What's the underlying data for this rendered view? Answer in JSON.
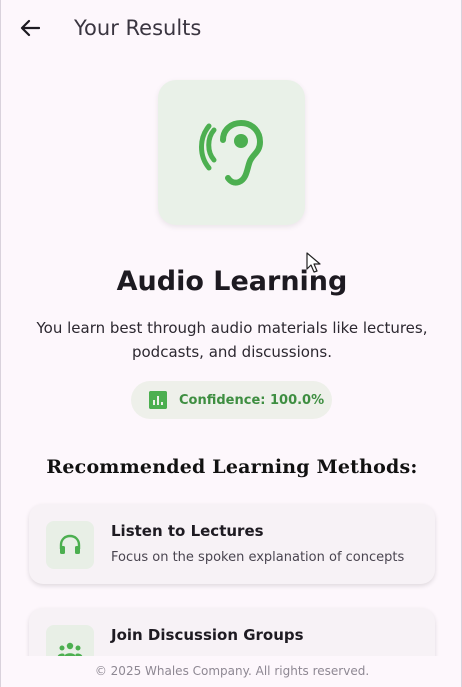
{
  "appbar": {
    "title": "Your Results",
    "back_icon": "arrow-left-icon"
  },
  "result": {
    "icon": "ear-hearing-icon",
    "style_title": "Audio Learning",
    "description": "You learn best through audio materials like lectures, podcasts, and discussions.",
    "confidence_label": "Confidence: 100.0%",
    "confidence_icon": "bar-chart-icon",
    "confidence_value": 100.0
  },
  "recommendations": {
    "heading": "Recommended Learning Methods:",
    "items": [
      {
        "icon": "headphones-icon",
        "title": "Listen to Lectures",
        "subtitle": "Focus on the spoken explanation of concepts"
      },
      {
        "icon": "groups-icon",
        "title": "Join Discussion Groups",
        "subtitle": ""
      }
    ]
  },
  "footer": {
    "text": "© 2025 Whales Company. All rights reserved."
  },
  "colors": {
    "accent_green": "#4caf50",
    "confidence_text": "#3e8e41",
    "background": "#fdf7fc"
  }
}
